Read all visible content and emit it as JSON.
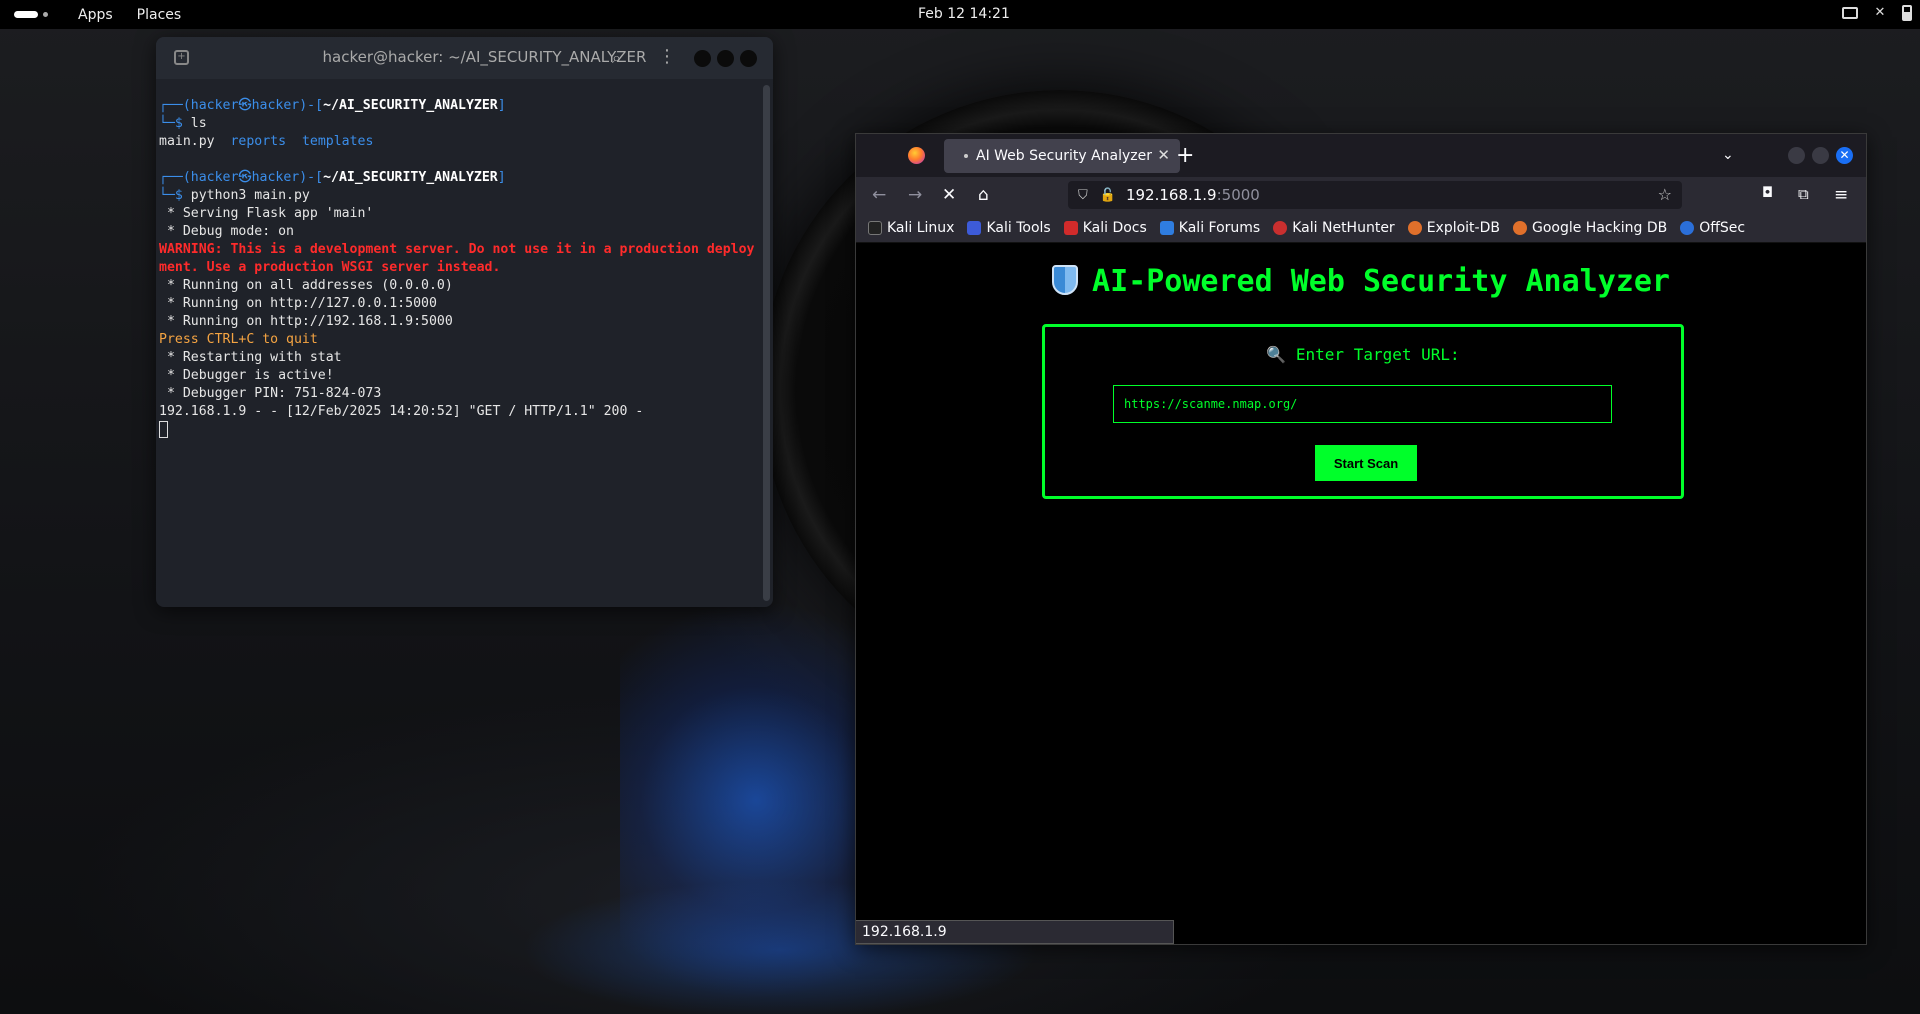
{
  "topbar": {
    "apps": "Apps",
    "places": "Places",
    "clock": "Feb 12  14:21"
  },
  "terminal": {
    "title": "hacker@hacker: ~/AI_SECURITY_ANALYZER",
    "prompt_user": "hacker",
    "prompt_host": "hacker",
    "prompt_dir": "~/AI_SECURITY_ANALYZER",
    "cmd1": "ls",
    "ls_file": "main.py",
    "ls_dir1": "reports",
    "ls_dir2": "templates",
    "cmd2": "python3 main.py",
    "out1": " * Serving Flask app 'main'",
    "out2": " * Debug mode: on",
    "warn1": "WARNING: This is a development server. Do not use it in a production deploy",
    "warn2": "ment. Use a production WSGI server instead.",
    "out3": " * Running on all addresses (0.0.0.0)",
    "out4": " * Running on http://127.0.0.1:5000",
    "out5": " * Running on http://192.168.1.9:5000",
    "quit": "Press CTRL+C to quit",
    "out6": " * Restarting with stat",
    "out7": " * Debugger is active!",
    "out8": " * Debugger PIN: 751-824-073",
    "log": "192.168.1.9 - - [12/Feb/2025 14:20:52] \"GET / HTTP/1.1\" 200 -"
  },
  "browser": {
    "tab_title": "AI Web Security Analyzer",
    "url_host": "192.168.1.9",
    "url_port": ":5000",
    "bookmarks": [
      {
        "label": "Kali Linux",
        "color": "#222222"
      },
      {
        "label": "Kali Tools",
        "color": "#3d5bd9"
      },
      {
        "label": "Kali Docs",
        "color": "#d12b2b"
      },
      {
        "label": "Kali Forums",
        "color": "#2f7de0"
      },
      {
        "label": "Kali NetHunter",
        "color": "#c92f2f"
      },
      {
        "label": "Exploit-DB",
        "color": "#e0702b"
      },
      {
        "label": "Google Hacking DB",
        "color": "#e0702b"
      },
      {
        "label": "OffSec",
        "color": "#2b6fd9"
      }
    ],
    "status_text": "192.168.1.9"
  },
  "app": {
    "title": "AI-Powered Web Security Analyzer",
    "label": "🔍 Enter Target URL:",
    "input_value": "https://scanme.nmap.org/",
    "button": "Start Scan"
  },
  "colors": {
    "accent": "#00ff2a",
    "terminal_bg": "#1f2229",
    "prompt_blue": "#3b8eea"
  }
}
